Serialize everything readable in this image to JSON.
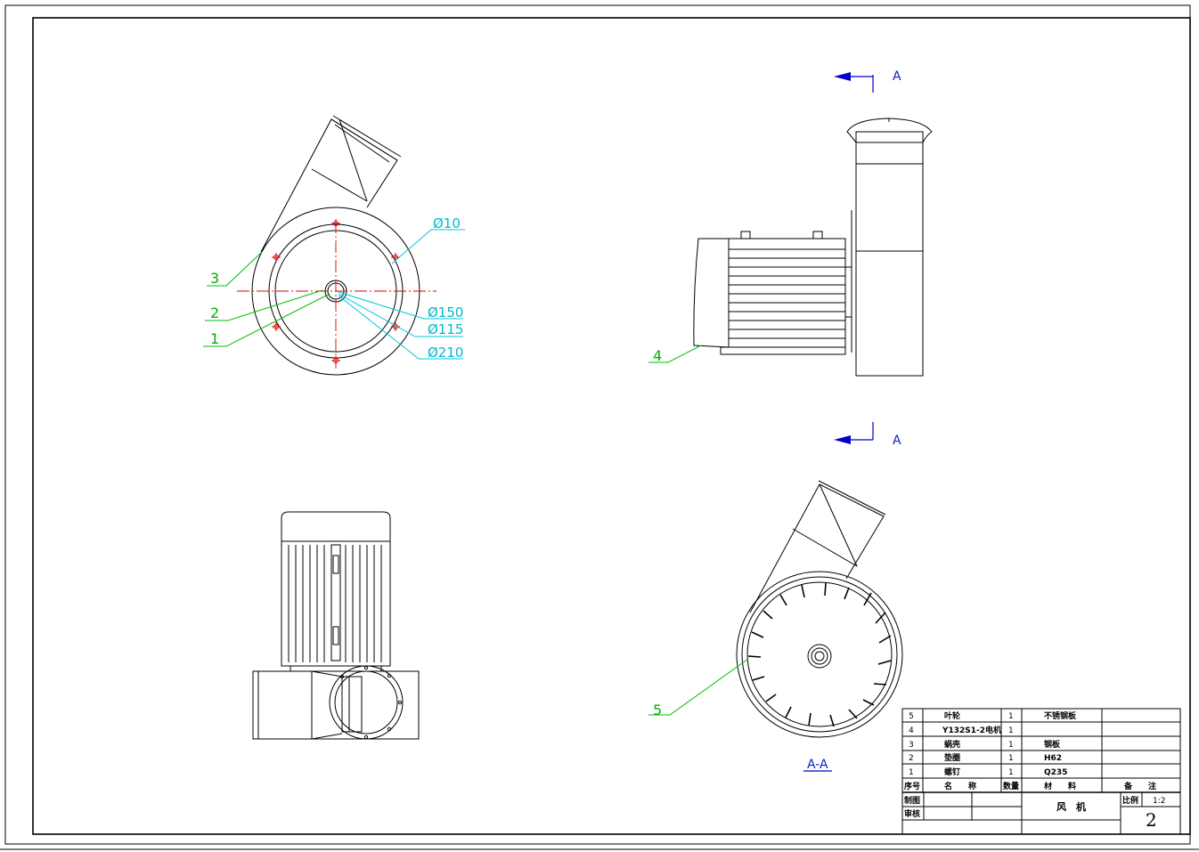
{
  "callouts": {
    "dia10": "Ø10",
    "dia150": "Ø150",
    "dia115": "Ø115",
    "dia210": "Ø210",
    "n1": "1",
    "n2": "2",
    "n3": "3",
    "n4": "4",
    "n5": "5"
  },
  "section": {
    "top": "A",
    "bottom": "A",
    "label": "A-A"
  },
  "parts_list": {
    "rows": [
      {
        "no": "5",
        "name": "叶轮",
        "qty": "1",
        "material": "不锈钢板",
        "note": ""
      },
      {
        "no": "4",
        "name": "Y132S1-2电机",
        "qty": "1",
        "material": "",
        "note": ""
      },
      {
        "no": "3",
        "name": "蜗壳",
        "qty": "1",
        "material": "钢板",
        "note": ""
      },
      {
        "no": "2",
        "name": "垫圈",
        "qty": "1",
        "material": "H62",
        "note": ""
      },
      {
        "no": "1",
        "name": "螺钉",
        "qty": "1",
        "material": "Q235",
        "note": ""
      }
    ],
    "header": {
      "no": "序号",
      "name": "名　　称",
      "qty": "数量",
      "material": "材　　料",
      "note": "备　　注"
    }
  },
  "title_block": {
    "drawn_by": "制图",
    "checked_by": "审核",
    "title": "风　机",
    "scale_label": "比例",
    "scale_value": "1:2",
    "sheet": "2"
  }
}
